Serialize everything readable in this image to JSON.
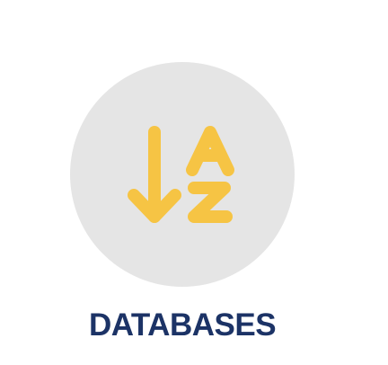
{
  "tile": {
    "label": "DATABASES",
    "icon": "sort-alphabetical-icon",
    "icon_letters": {
      "top": "A",
      "bottom": "Z"
    }
  },
  "colors": {
    "circle_background": "#e5e5e5",
    "icon": "#f6c444",
    "label": "#1c3366"
  }
}
